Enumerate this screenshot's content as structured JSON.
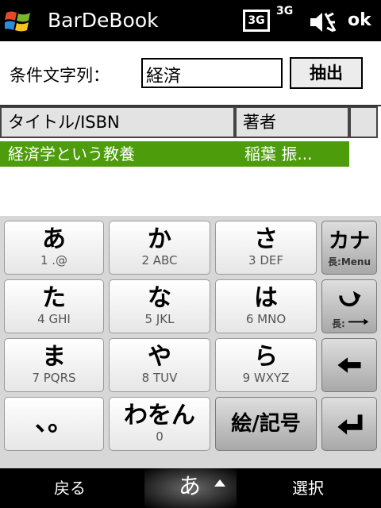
{
  "statusbar": {
    "app_title": "BarDeBook",
    "network_box": "3G",
    "network_signal": "3G",
    "ok_label": "ok"
  },
  "search": {
    "label": "条件文字列：",
    "input_value": "経済",
    "extract_button": "抽出"
  },
  "list": {
    "columns": [
      "タイトル/ISBN",
      "著者"
    ],
    "rows": [
      {
        "title": "経済学という教養",
        "author": "稲葉 振..."
      }
    ]
  },
  "keyboard": {
    "keys": [
      {
        "main": "あ",
        "sub": "1 .@"
      },
      {
        "main": "か",
        "sub": "2 ABC"
      },
      {
        "main": "さ",
        "sub": "3 DEF"
      },
      {
        "main": "カナ",
        "sub": "長:Menu"
      },
      {
        "main": "た",
        "sub": "4 GHI"
      },
      {
        "main": "な",
        "sub": "5 JKL"
      },
      {
        "main": "は",
        "sub": "6 MNO"
      },
      {
        "main": "",
        "sub": "長:"
      },
      {
        "main": "ま",
        "sub": "7 PQRS"
      },
      {
        "main": "や",
        "sub": "8 TUV"
      },
      {
        "main": "ら",
        "sub": "9 WXYZ"
      },
      {
        "main": "",
        "sub": ""
      },
      {
        "main": "、。",
        "sub": ""
      },
      {
        "main": "わをん",
        "sub": "0"
      },
      {
        "main": "絵/記号",
        "sub": ""
      },
      {
        "main": "",
        "sub": ""
      }
    ]
  },
  "softkeys": {
    "left": "戻る",
    "middle": "あ",
    "right": "選択"
  },
  "colors": {
    "selection_green": "#4c9c0c",
    "header_bg": "#e3e3e3",
    "bar_bg": "#000000"
  },
  "icons": {
    "windows": "windows-logo-icon",
    "volume": "speaker-muted-icon",
    "undo": "undo-arrow-icon",
    "backspace": "left-arrow-icon",
    "enter": "enter-return-icon",
    "menu_up": "up-triangle-icon"
  }
}
